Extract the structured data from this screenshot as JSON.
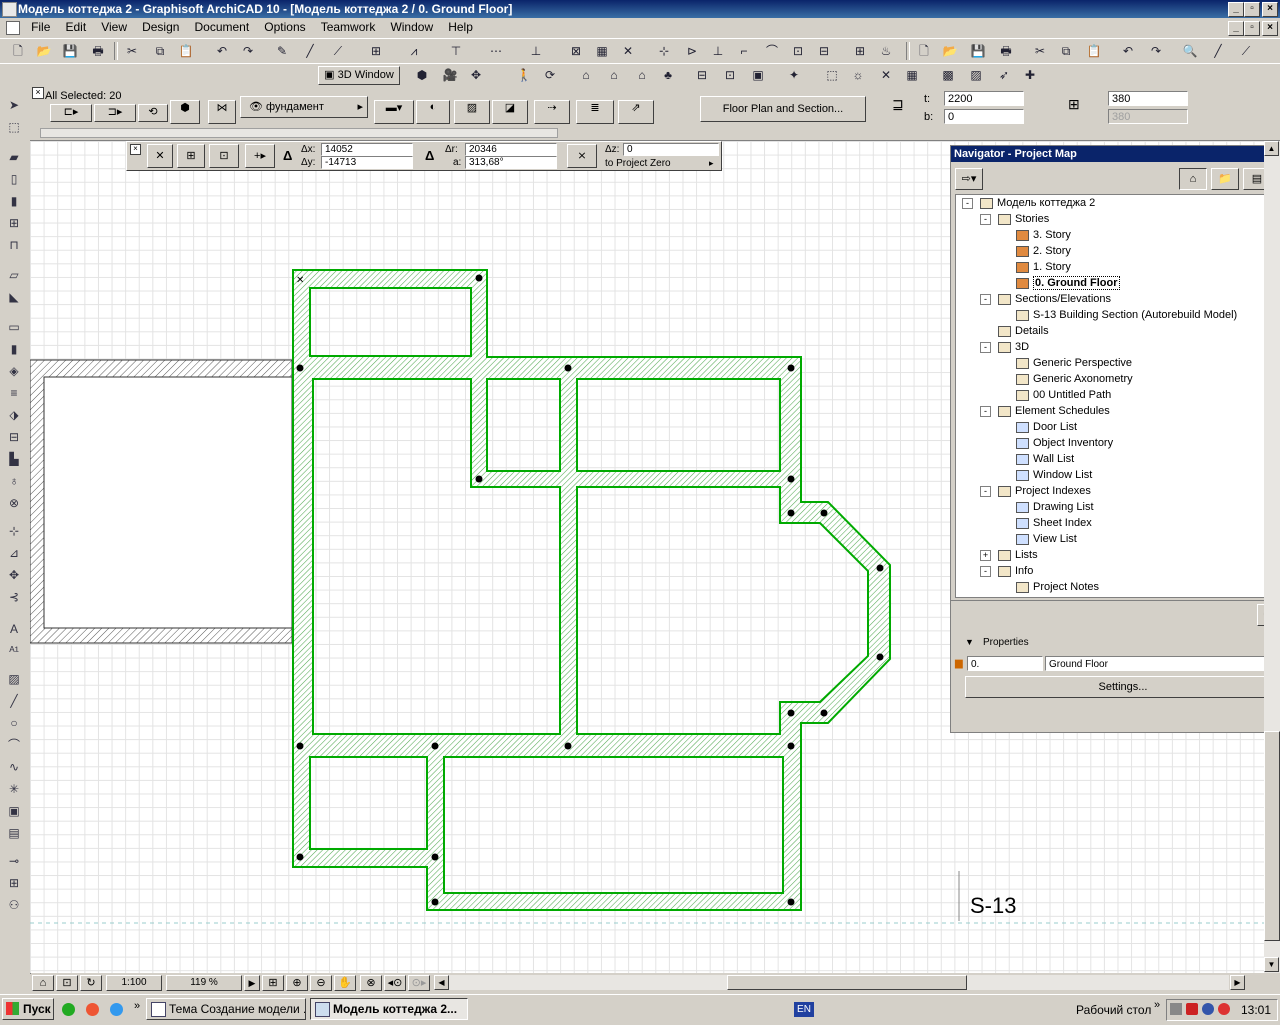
{
  "window": {
    "title": "Модель коттеджа 2 - Graphisoft ArchiCAD 10 - [Модель коттеджа 2 / 0. Ground Floor]"
  },
  "menu": [
    "File",
    "Edit",
    "View",
    "Design",
    "Document",
    "Options",
    "Teamwork",
    "Window",
    "Help"
  ],
  "toolbar2": {
    "window3d_label": "3D Window"
  },
  "infobox": {
    "selection": "All Selected: 20",
    "layer_label": "фундамент",
    "floorplan_button": "Floor Plan and Section...",
    "t_label": "t:",
    "t_value": "2200",
    "b_label": "b:",
    "b_value": "0",
    "h_value": "380",
    "h_value2": "380"
  },
  "coords": {
    "dx_label": "Δx:",
    "dx": "14052",
    "dy_label": "Δy:",
    "dy": "-14713",
    "dr_label": "Δr:",
    "dr": "20346",
    "a_label": "a:",
    "a": "313,68°",
    "dz_label": "Δz:",
    "dz": "0",
    "reference": "to Project Zero"
  },
  "drawing": {
    "section_label": "S-13",
    "wall_color": "#00aa00"
  },
  "navigator": {
    "title": "Navigator - Project Map",
    "tree": [
      {
        "label": "Модель коттеджа 2",
        "level": 0,
        "icon": "house-icon",
        "pm": "-"
      },
      {
        "label": "Stories",
        "level": 1,
        "icon": "stories-icon",
        "pm": "-"
      },
      {
        "label": "3. Story",
        "level": 2,
        "icon": "story-icon"
      },
      {
        "label": "2. Story",
        "level": 2,
        "icon": "story-icon"
      },
      {
        "label": "1. Story",
        "level": 2,
        "icon": "story-icon"
      },
      {
        "label": "0. Ground Floor",
        "level": 2,
        "icon": "story-icon",
        "selected": true
      },
      {
        "label": "Sections/Elevations",
        "level": 1,
        "icon": "section-icon",
        "pm": "-"
      },
      {
        "label": "S-13 Building Section (Autorebuild Model)",
        "level": 2,
        "icon": "building-section-icon"
      },
      {
        "label": "Details",
        "level": 1,
        "icon": "details-icon"
      },
      {
        "label": "3D",
        "level": 1,
        "icon": "3d-icon",
        "pm": "-"
      },
      {
        "label": "Generic Perspective",
        "level": 2,
        "icon": "camera-icon"
      },
      {
        "label": "Generic Axonometry",
        "level": 2,
        "icon": "axonometry-icon"
      },
      {
        "label": "00 Untitled Path",
        "level": 2,
        "icon": "path-icon"
      },
      {
        "label": "Element Schedules",
        "level": 1,
        "icon": "schedule-icon",
        "pm": "-"
      },
      {
        "label": "Door List",
        "level": 2,
        "icon": "list-icon"
      },
      {
        "label": "Object Inventory",
        "level": 2,
        "icon": "list-icon"
      },
      {
        "label": "Wall List",
        "level": 2,
        "icon": "list-icon"
      },
      {
        "label": "Window List",
        "level": 2,
        "icon": "list-icon"
      },
      {
        "label": "Project Indexes",
        "level": 1,
        "icon": "index-icon",
        "pm": "-"
      },
      {
        "label": "Drawing List",
        "level": 2,
        "icon": "list-icon"
      },
      {
        "label": "Sheet Index",
        "level": 2,
        "icon": "list-icon"
      },
      {
        "label": "View List",
        "level": 2,
        "icon": "list-icon"
      },
      {
        "label": "Lists",
        "level": 1,
        "icon": "lists-icon",
        "pm": "+"
      },
      {
        "label": "Info",
        "level": 1,
        "icon": "info-icon",
        "pm": "-"
      },
      {
        "label": "Project Notes",
        "level": 2,
        "icon": "notes-icon"
      }
    ],
    "properties_label": "Properties",
    "story_number": "0.",
    "story_name": "Ground Floor",
    "settings_button": "Settings..."
  },
  "status": {
    "scale": "1:100",
    "zoom": "119 %"
  },
  "taskbar": {
    "start": "Пуск",
    "tasks": [
      {
        "label": "Тема Создание модели ...",
        "active": false
      },
      {
        "label": "Модель коттеджа 2...",
        "active": true
      }
    ],
    "lang": "EN",
    "desktop": "Рабочий стол",
    "clock": "13:01"
  }
}
